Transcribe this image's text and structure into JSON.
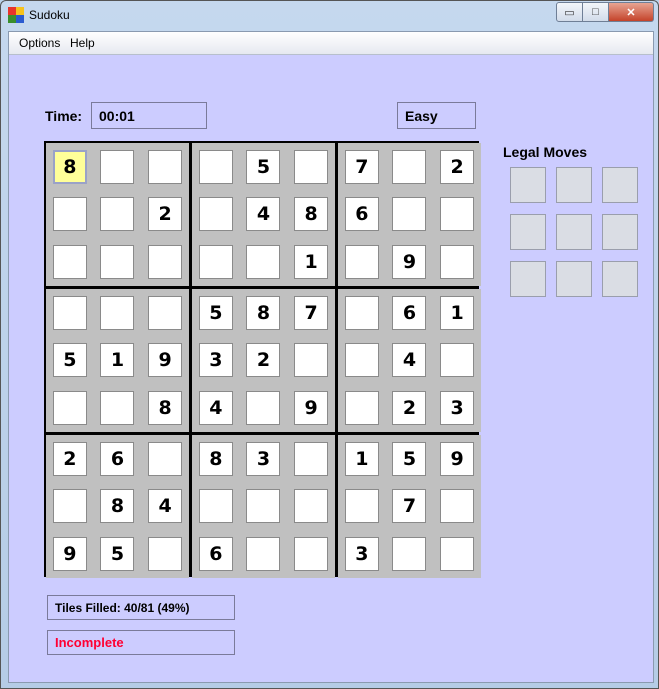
{
  "window": {
    "title": "Sudoku",
    "min_glyph": "▭",
    "max_glyph": "□",
    "close_glyph": "✕"
  },
  "menu": {
    "items": [
      "Options",
      "Help"
    ]
  },
  "timer": {
    "label": "Time:",
    "value": "00:01"
  },
  "difficulty": "Easy",
  "board": [
    [
      "8",
      "",
      "",
      "",
      "5",
      "",
      "7",
      "",
      "2"
    ],
    [
      "",
      "",
      "2",
      "",
      "4",
      "8",
      "6",
      "",
      ""
    ],
    [
      "",
      "",
      "",
      "",
      "",
      "1",
      "",
      "9",
      ""
    ],
    [
      "",
      "",
      "",
      "5",
      "8",
      "7",
      "",
      "6",
      "1"
    ],
    [
      "5",
      "1",
      "9",
      "3",
      "2",
      "",
      "",
      "4",
      ""
    ],
    [
      "",
      "",
      "8",
      "4",
      "",
      "9",
      "",
      "2",
      "3"
    ],
    [
      "2",
      "6",
      "",
      "8",
      "3",
      "",
      "1",
      "5",
      "9"
    ],
    [
      "",
      "8",
      "4",
      "",
      "",
      "",
      "",
      "7",
      ""
    ],
    [
      "9",
      "5",
      "",
      "6",
      "",
      "",
      "3",
      "",
      ""
    ]
  ],
  "selected_cell": [
    0,
    0
  ],
  "legal_moves": {
    "title": "Legal Moves",
    "values": [
      "",
      "",
      "",
      "",
      "",
      "",
      "",
      "",
      ""
    ]
  },
  "status": {
    "tiles_filled": "Tiles Filled: 40/81 (49%)",
    "state": "Incomplete"
  },
  "colors": {
    "background": "#ccccff",
    "selected": "#ffff99",
    "incomplete": "#ff0033",
    "box_bg": "#c0c0c0"
  }
}
